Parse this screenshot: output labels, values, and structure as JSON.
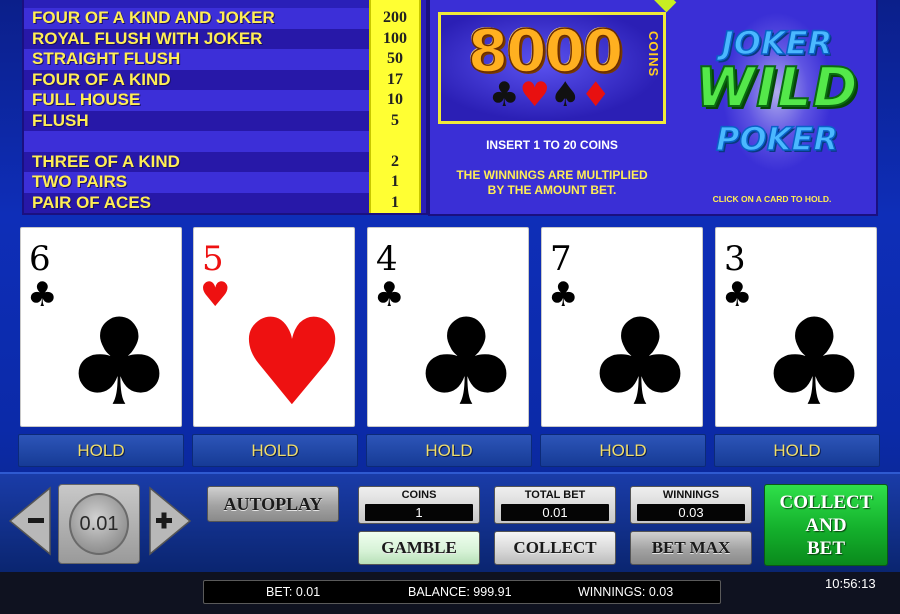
{
  "paytable": {
    "rows": [
      {
        "hand": "FOUR OF A KIND AND JOKER",
        "payout": "200"
      },
      {
        "hand": "ROYAL FLUSH WITH JOKER",
        "payout": "100"
      },
      {
        "hand": "STRAIGHT FLUSH",
        "payout": "50"
      },
      {
        "hand": "FOUR OF A KIND",
        "payout": "17"
      },
      {
        "hand": "FULL HOUSE",
        "payout": "10"
      },
      {
        "hand": "FLUSH",
        "payout": "5"
      },
      {
        "hand": "",
        "payout": ""
      },
      {
        "hand": "THREE OF A KIND",
        "payout": "2"
      },
      {
        "hand": "TWO PAIRS",
        "payout": "1"
      },
      {
        "hand": "PAIR OF ACES",
        "payout": "1"
      }
    ]
  },
  "info": {
    "max_coins": "8000",
    "coins_label": "COINS",
    "insert_text": "INSERT 1 TO 20 COINS",
    "multiplier_text_1": "THE WINNINGS ARE MULTIPLIED",
    "multiplier_text_2": "BY THE AMOUNT BET.",
    "hold_hint": "CLICK ON A CARD TO HOLD."
  },
  "logo": {
    "line1": "JOKER",
    "line2": "WILD",
    "line3": "POKER"
  },
  "cards": [
    {
      "rank": "6",
      "suit": "♣",
      "color": "black"
    },
    {
      "rank": "5",
      "suit": "♥",
      "color": "red"
    },
    {
      "rank": "4",
      "suit": "♣",
      "color": "black"
    },
    {
      "rank": "7",
      "suit": "♣",
      "color": "black"
    },
    {
      "rank": "3",
      "suit": "♣",
      "color": "black"
    }
  ],
  "hold_label": "HOLD",
  "controls": {
    "decrease_icon": "minus-icon",
    "increase_icon": "plus-icon",
    "denomination": "0.01",
    "autoplay": "AUTOPLAY",
    "coins_label": "COINS",
    "coins_value": "1",
    "total_bet_label": "TOTAL BET",
    "total_bet_value": "0.01",
    "winnings_label": "WINNINGS",
    "winnings_value": "0.03",
    "gamble": "GAMBLE",
    "collect": "COLLECT",
    "bet_max": "BET MAX",
    "collect_and_bet_1": "COLLECT",
    "collect_and_bet_2": "AND",
    "collect_and_bet_3": "BET"
  },
  "status": {
    "bet": "BET: 0.01",
    "balance": "BALANCE: 999.91",
    "winnings": "WINNINGS: 0.03",
    "time": "10:56:13"
  },
  "colors": {
    "background": "#0e2eb8",
    "paytable_highlight": "#ffff33",
    "paytable_text": "#ffee55",
    "collect_and_bet": "#14b02c",
    "card_red": "#ee1111"
  }
}
